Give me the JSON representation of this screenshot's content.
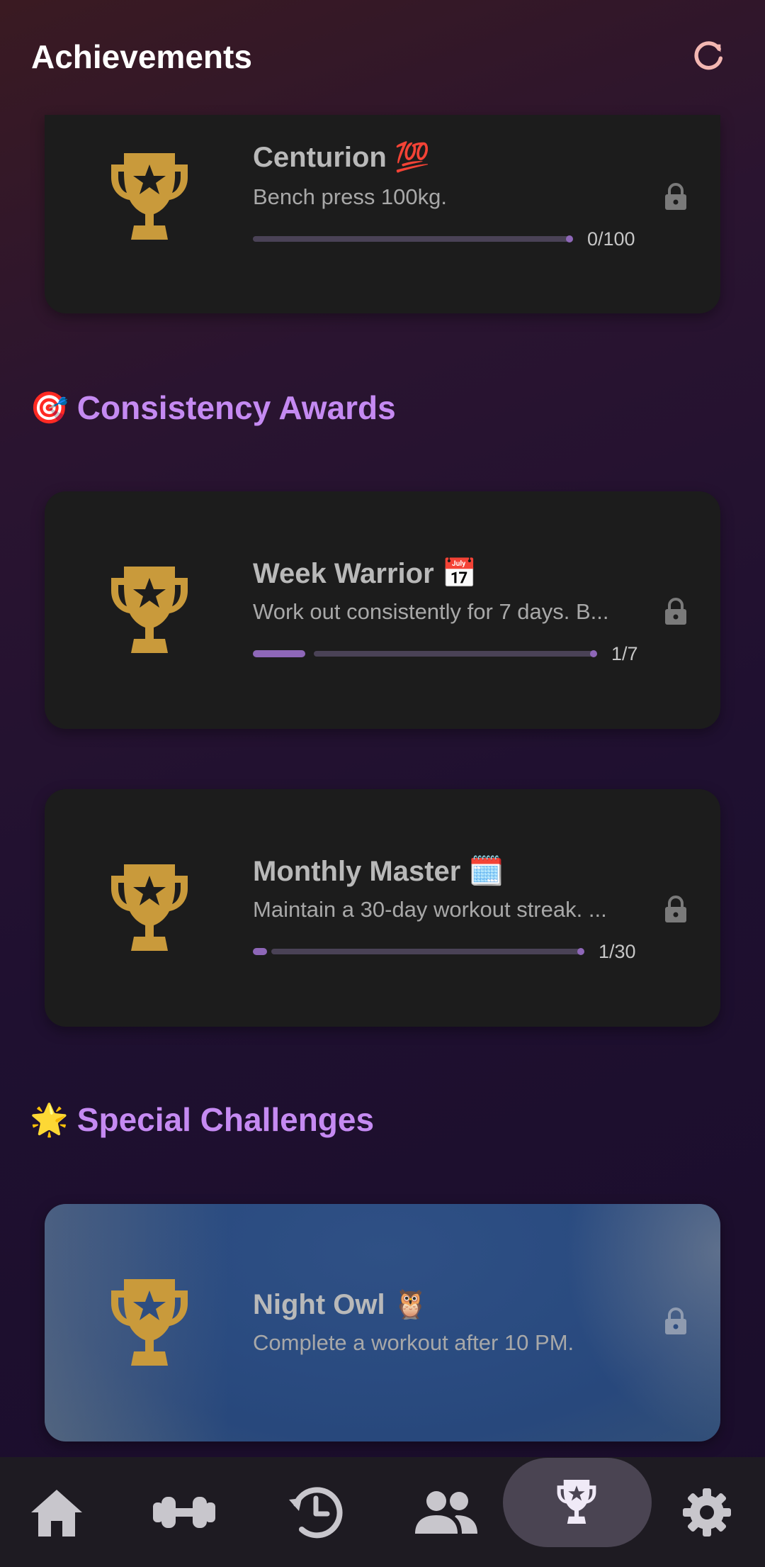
{
  "header": {
    "title": "Achievements"
  },
  "sections": [
    {
      "emoji": "🎯",
      "title": "Consistency Awards"
    },
    {
      "emoji": "🌟",
      "title": "Special Challenges"
    }
  ],
  "achievements": {
    "centurion": {
      "title": "Centurion 💯",
      "description": "Bench press 100kg.",
      "progress_text": "0/100",
      "progress": 0.0
    },
    "week_warrior": {
      "title": "Week Warrior 📅",
      "description": "Work out consistently for 7 days. B...",
      "progress_text": "1/7",
      "progress": 0.142
    },
    "monthly_master": {
      "title": "Monthly Master 🗓️",
      "description": "Maintain a 30-day workout streak. ...",
      "progress_text": "1/30",
      "progress": 0.033
    },
    "night_owl": {
      "title": "Night Owl 🦉",
      "description": "Complete a workout after 10 PM."
    }
  },
  "nav": {
    "items": [
      "home-icon",
      "dumbbell-icon",
      "history-icon",
      "friends-icon",
      "trophy-icon",
      "settings-icon"
    ],
    "active": "trophy-icon"
  },
  "colors": {
    "accent": "#c58af2",
    "trophy": "#c99a3b",
    "progress": "#8e67b8"
  }
}
